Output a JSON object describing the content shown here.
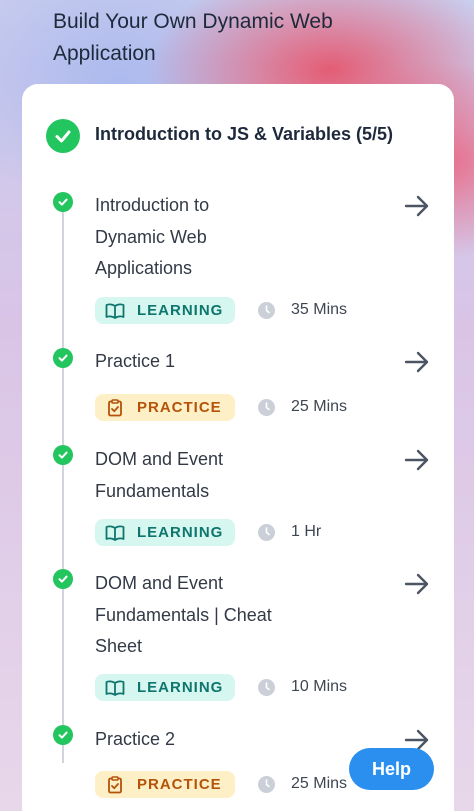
{
  "course": {
    "title": "Build Your Own Dynamic Web Application"
  },
  "module": {
    "title": "Introduction to JS & Variables (5/5)"
  },
  "items": [
    {
      "title": "Introduction to Dynamic Web Applications",
      "type": "LEARNING",
      "duration": "35 Mins",
      "completed": true
    },
    {
      "title": "Practice 1",
      "type": "PRACTICE",
      "duration": "25 Mins",
      "completed": true
    },
    {
      "title": "DOM and Event Fundamentals",
      "type": "LEARNING",
      "duration": "1 Hr",
      "completed": true
    },
    {
      "title": "DOM and Event Fundamentals | Cheat Sheet",
      "type": "LEARNING",
      "duration": "10 Mins",
      "completed": true
    },
    {
      "title": "Practice 2",
      "type": "PRACTICE",
      "duration": "25 Mins",
      "completed": true
    }
  ],
  "help_button": {
    "label": "Help"
  },
  "colors": {
    "success": "#22c55e",
    "learning_bg": "#d6f6f0",
    "learning_text": "#0f766e",
    "practice_bg": "#fdefc6",
    "practice_text": "#b45309",
    "help": "#2b8ff0"
  },
  "icons": {
    "module_status": "check-circle-icon",
    "learning": "book-open-icon",
    "practice": "clipboard-check-icon",
    "duration": "clock-icon",
    "navigate": "arrow-right-icon"
  }
}
